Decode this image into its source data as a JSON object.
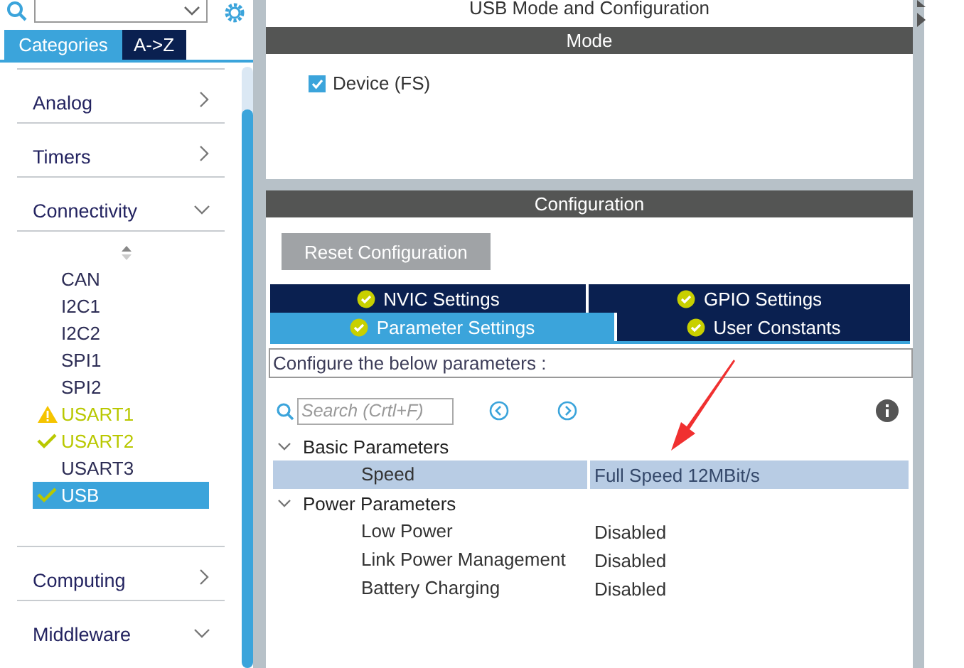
{
  "sidebar": {
    "tabs": [
      {
        "label": "Categories",
        "selected": true
      },
      {
        "label": "A->Z",
        "selected": false
      }
    ],
    "categories": [
      {
        "label": "Analog",
        "expanded": false
      },
      {
        "label": "Timers",
        "expanded": false
      },
      {
        "label": "Connectivity",
        "expanded": true,
        "children": [
          {
            "label": "CAN",
            "kind": "plain",
            "selected": false
          },
          {
            "label": "I2C1",
            "kind": "plain",
            "selected": false
          },
          {
            "label": "I2C2",
            "kind": "plain",
            "selected": false
          },
          {
            "label": "SPI1",
            "kind": "plain",
            "selected": false
          },
          {
            "label": "SPI2",
            "kind": "plain",
            "selected": false
          },
          {
            "label": "USART1",
            "kind": "warning",
            "selected": false
          },
          {
            "label": "USART2",
            "kind": "ok",
            "selected": false
          },
          {
            "label": "USART3",
            "kind": "plain",
            "selected": false
          },
          {
            "label": "USB",
            "kind": "ok",
            "selected": true
          }
        ]
      },
      {
        "label": "Computing",
        "expanded": false
      },
      {
        "label": "Middleware",
        "expanded": true
      }
    ]
  },
  "main": {
    "title": "USB Mode and Configuration",
    "mode": {
      "header": "Mode",
      "options": [
        {
          "label": "Device (FS)",
          "checked": true
        }
      ]
    },
    "configuration": {
      "header": "Configuration",
      "reset_button": "Reset Configuration",
      "tab_rows": [
        [
          {
            "label": "NVIC Settings",
            "selected": false
          },
          {
            "label": "GPIO Settings",
            "selected": false
          }
        ],
        [
          {
            "label": "Parameter Settings",
            "selected": true
          },
          {
            "label": "User Constants",
            "selected": false
          }
        ]
      ],
      "hint": "Configure the below parameters :",
      "search": {
        "placeholder": "Search (Crtl+F)"
      },
      "groups": [
        {
          "label": "Basic Parameters",
          "expanded": true,
          "params": [
            {
              "name": "Speed",
              "value": "Full Speed 12MBit/s",
              "selected": true
            }
          ]
        },
        {
          "label": "Power Parameters",
          "expanded": true,
          "params": [
            {
              "name": "Low Power",
              "value": "Disabled",
              "selected": false
            },
            {
              "name": "Link Power Management",
              "value": "Disabled",
              "selected": false
            },
            {
              "name": "Battery Charging",
              "value": "Disabled",
              "selected": false
            }
          ]
        }
      ]
    }
  }
}
